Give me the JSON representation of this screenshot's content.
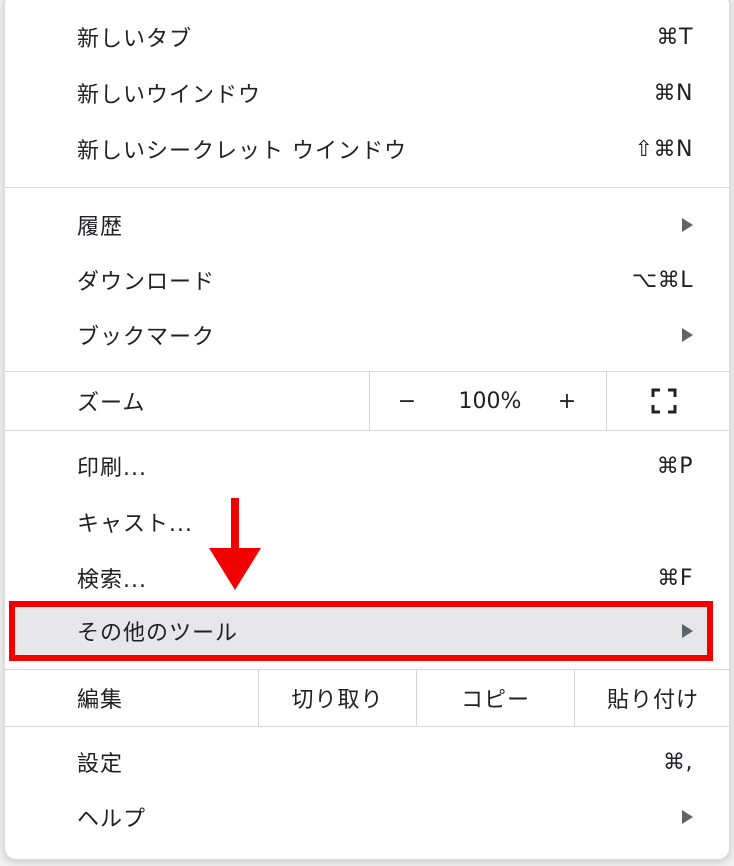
{
  "menu": {
    "new_tab": {
      "label": "新しいタブ",
      "shortcut": "⌘T"
    },
    "new_window": {
      "label": "新しいウインドウ",
      "shortcut": "⌘N"
    },
    "new_incognito": {
      "label": "新しいシークレット ウインドウ",
      "shortcut": "⇧⌘N"
    },
    "history": {
      "label": "履歴"
    },
    "downloads": {
      "label": "ダウンロード",
      "shortcut": "⌥⌘L"
    },
    "bookmarks": {
      "label": "ブックマーク"
    },
    "zoom": {
      "label": "ズーム",
      "minus": "−",
      "level": "100%",
      "plus": "+"
    },
    "print": {
      "label": "印刷...",
      "shortcut": "⌘P"
    },
    "cast": {
      "label": "キャスト..."
    },
    "find": {
      "label": "検索...",
      "shortcut": "⌘F"
    },
    "more_tools": {
      "label": "その他のツール"
    },
    "edit": {
      "label": "編集",
      "cut": "切り取り",
      "copy": "コピー",
      "paste": "貼り付け"
    },
    "settings": {
      "label": "設定",
      "shortcut": "⌘,"
    },
    "help": {
      "label": "ヘルプ"
    }
  },
  "colors": {
    "highlight_border": "#f20000",
    "highlight_fill": "#e7e7ea",
    "annotation_arrow": "#f20000"
  },
  "icons": {
    "submenu": "triangle-right-icon",
    "fullscreen": "fullscreen-icon",
    "annotation": "red-down-arrow-icon"
  }
}
